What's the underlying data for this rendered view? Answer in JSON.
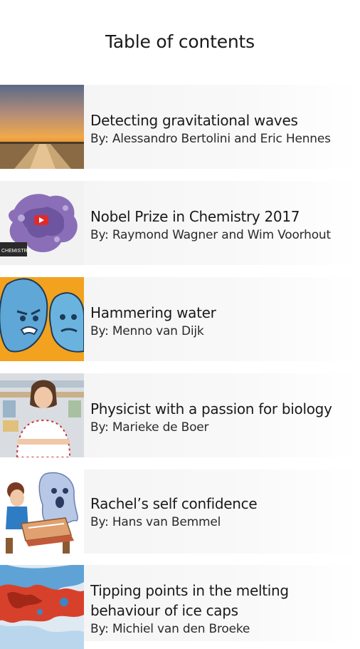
{
  "header": {
    "title": "Table of contents"
  },
  "articles": [
    {
      "title": "Detecting gravitational waves",
      "author": "By: Alessandro Bertolini and Eric Hennes",
      "thumbnail": "sunset-canal-image"
    },
    {
      "title": "Nobel Prize in Chemistry 2017",
      "author": "By: Raymond Wagner and Wim Voorhout",
      "thumbnail": "protein-video-image",
      "video_badge": "CHEMISTRY"
    },
    {
      "title": "Hammering water",
      "author": "By: Menno van Dijk",
      "thumbnail": "water-drop-cartoon"
    },
    {
      "title": "Physicist with a passion for biology",
      "author": "By: Marieke de Boer",
      "thumbnail": "scientist-portrait"
    },
    {
      "title": "Rachel’s self confidence",
      "author": "By: Hans van Bemmel",
      "thumbnail": "ghost-cartoon"
    },
    {
      "title": "Tipping points in the melting behaviour of ice caps",
      "author": "By: Michiel van den Broeke",
      "thumbnail": "ice-cap-map"
    }
  ]
}
